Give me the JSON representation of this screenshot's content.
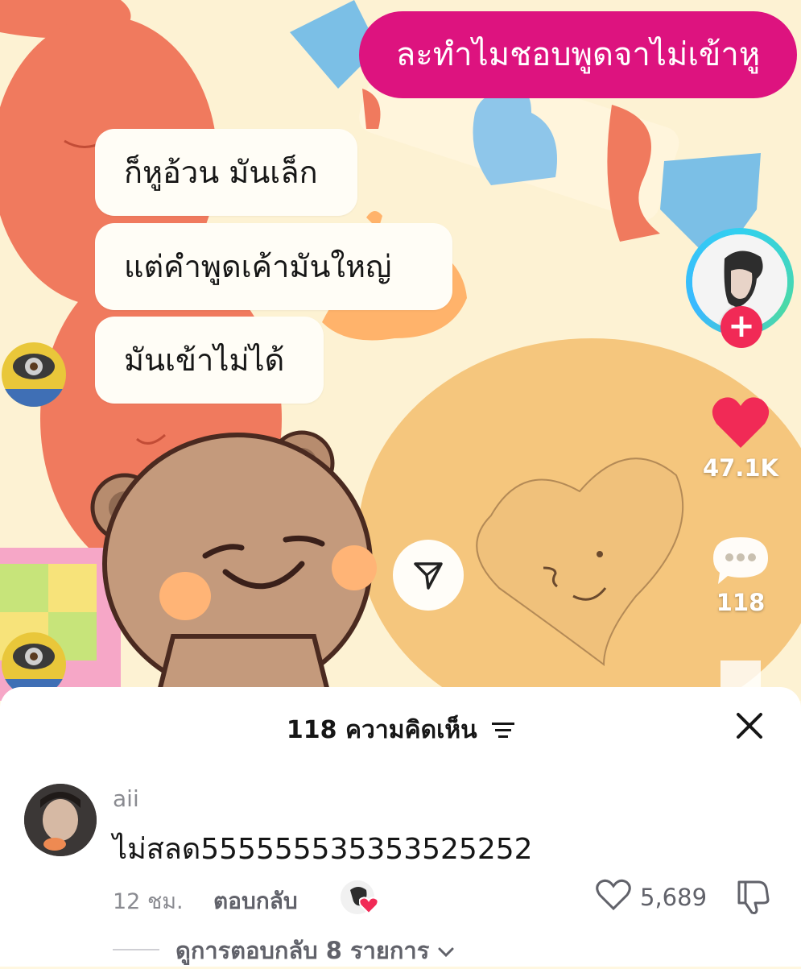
{
  "video": {
    "caption_pink": "ละทำไมชอบพูดจาไม่เข้าหู",
    "caption_lines": [
      "ก็หูอ้วน มันเล็ก",
      "แต่คำพูดเค้ามันใหญ่",
      "มันเข้าไม่ได้"
    ]
  },
  "actions": {
    "follow_label": "+",
    "likes": "47.1K",
    "comments": "118"
  },
  "comments_sheet": {
    "title": "118 ความคิดเห็น",
    "comment": {
      "username": "aii",
      "text": "ไม่สลด555555535353525252",
      "time": "12 ชม.",
      "reply_label": "ตอบกลับ",
      "like_count": "5,689"
    },
    "view_replies": "ดูการตอบกลับ 8 รายการ"
  },
  "colors": {
    "accent_pink": "#dd137f",
    "like_red": "#f12a56",
    "bubble_bg": "#fffdf6"
  },
  "icons": [
    "creator-avatar-icon",
    "heart-icon",
    "comment-icon",
    "share-icon",
    "filter-icon",
    "close-icon",
    "like-icon",
    "dislike-icon",
    "chevron-down-icon"
  ]
}
